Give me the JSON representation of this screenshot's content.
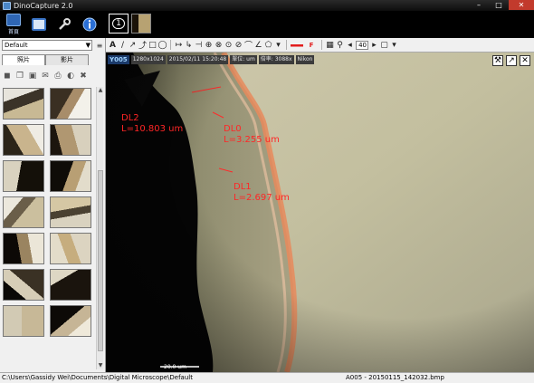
{
  "window": {
    "title": "DinoCapture 2.0"
  },
  "main_toolbar": {
    "home_label": "首頁",
    "preview_number": "1"
  },
  "left_panel": {
    "profile": "Default",
    "tabs": [
      {
        "label": "照片"
      },
      {
        "label": "影片"
      }
    ]
  },
  "draw_toolbar": {
    "zoom_value": "40"
  },
  "viewer": {
    "camera_id": "Y005",
    "resolution": "1280x1024",
    "datetime": "2015/02/11 15:20:48",
    "unit_label": "單位: um",
    "magnification": "倍率: 3088x",
    "lens": "Nikon",
    "scale_bar": "20.0 um",
    "measurements": [
      {
        "name": "DL2",
        "value": "L=10.803 um"
      },
      {
        "name": "DL0",
        "value": "L=3.255 um"
      },
      {
        "name": "DL1",
        "value": "L=2.697 um"
      }
    ]
  },
  "statusbar": {
    "path": "C:\\Users\\Gassidy Wei\\Documents\\Digital Microscope\\Default",
    "file": "A005 - 20150115_142032.bmp"
  },
  "colors": {
    "measure": "#ff2626",
    "accent": "#4b87c8"
  }
}
